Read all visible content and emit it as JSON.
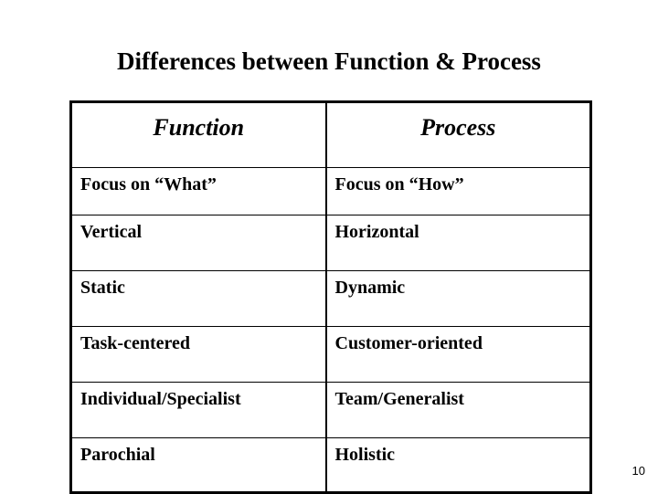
{
  "slide": {
    "title": "Differences between Function & Process",
    "page_number": "10",
    "background_color": "#ffffff",
    "text_color": "#000000",
    "border_color": "#000000"
  },
  "table": {
    "headers": {
      "left": "Function",
      "right": "Process"
    },
    "rows": [
      {
        "function": "Focus on “What”",
        "process": "Focus on “How”"
      },
      {
        "function": "Vertical",
        "process": "Horizontal"
      },
      {
        "function": "Static",
        "process": "Dynamic"
      },
      {
        "function": "Task-centered",
        "process": "Customer-oriented"
      },
      {
        "function": "Individual/Specialist",
        "process": "Team/Generalist"
      },
      {
        "function": "Parochial",
        "process": "Holistic"
      }
    ]
  }
}
